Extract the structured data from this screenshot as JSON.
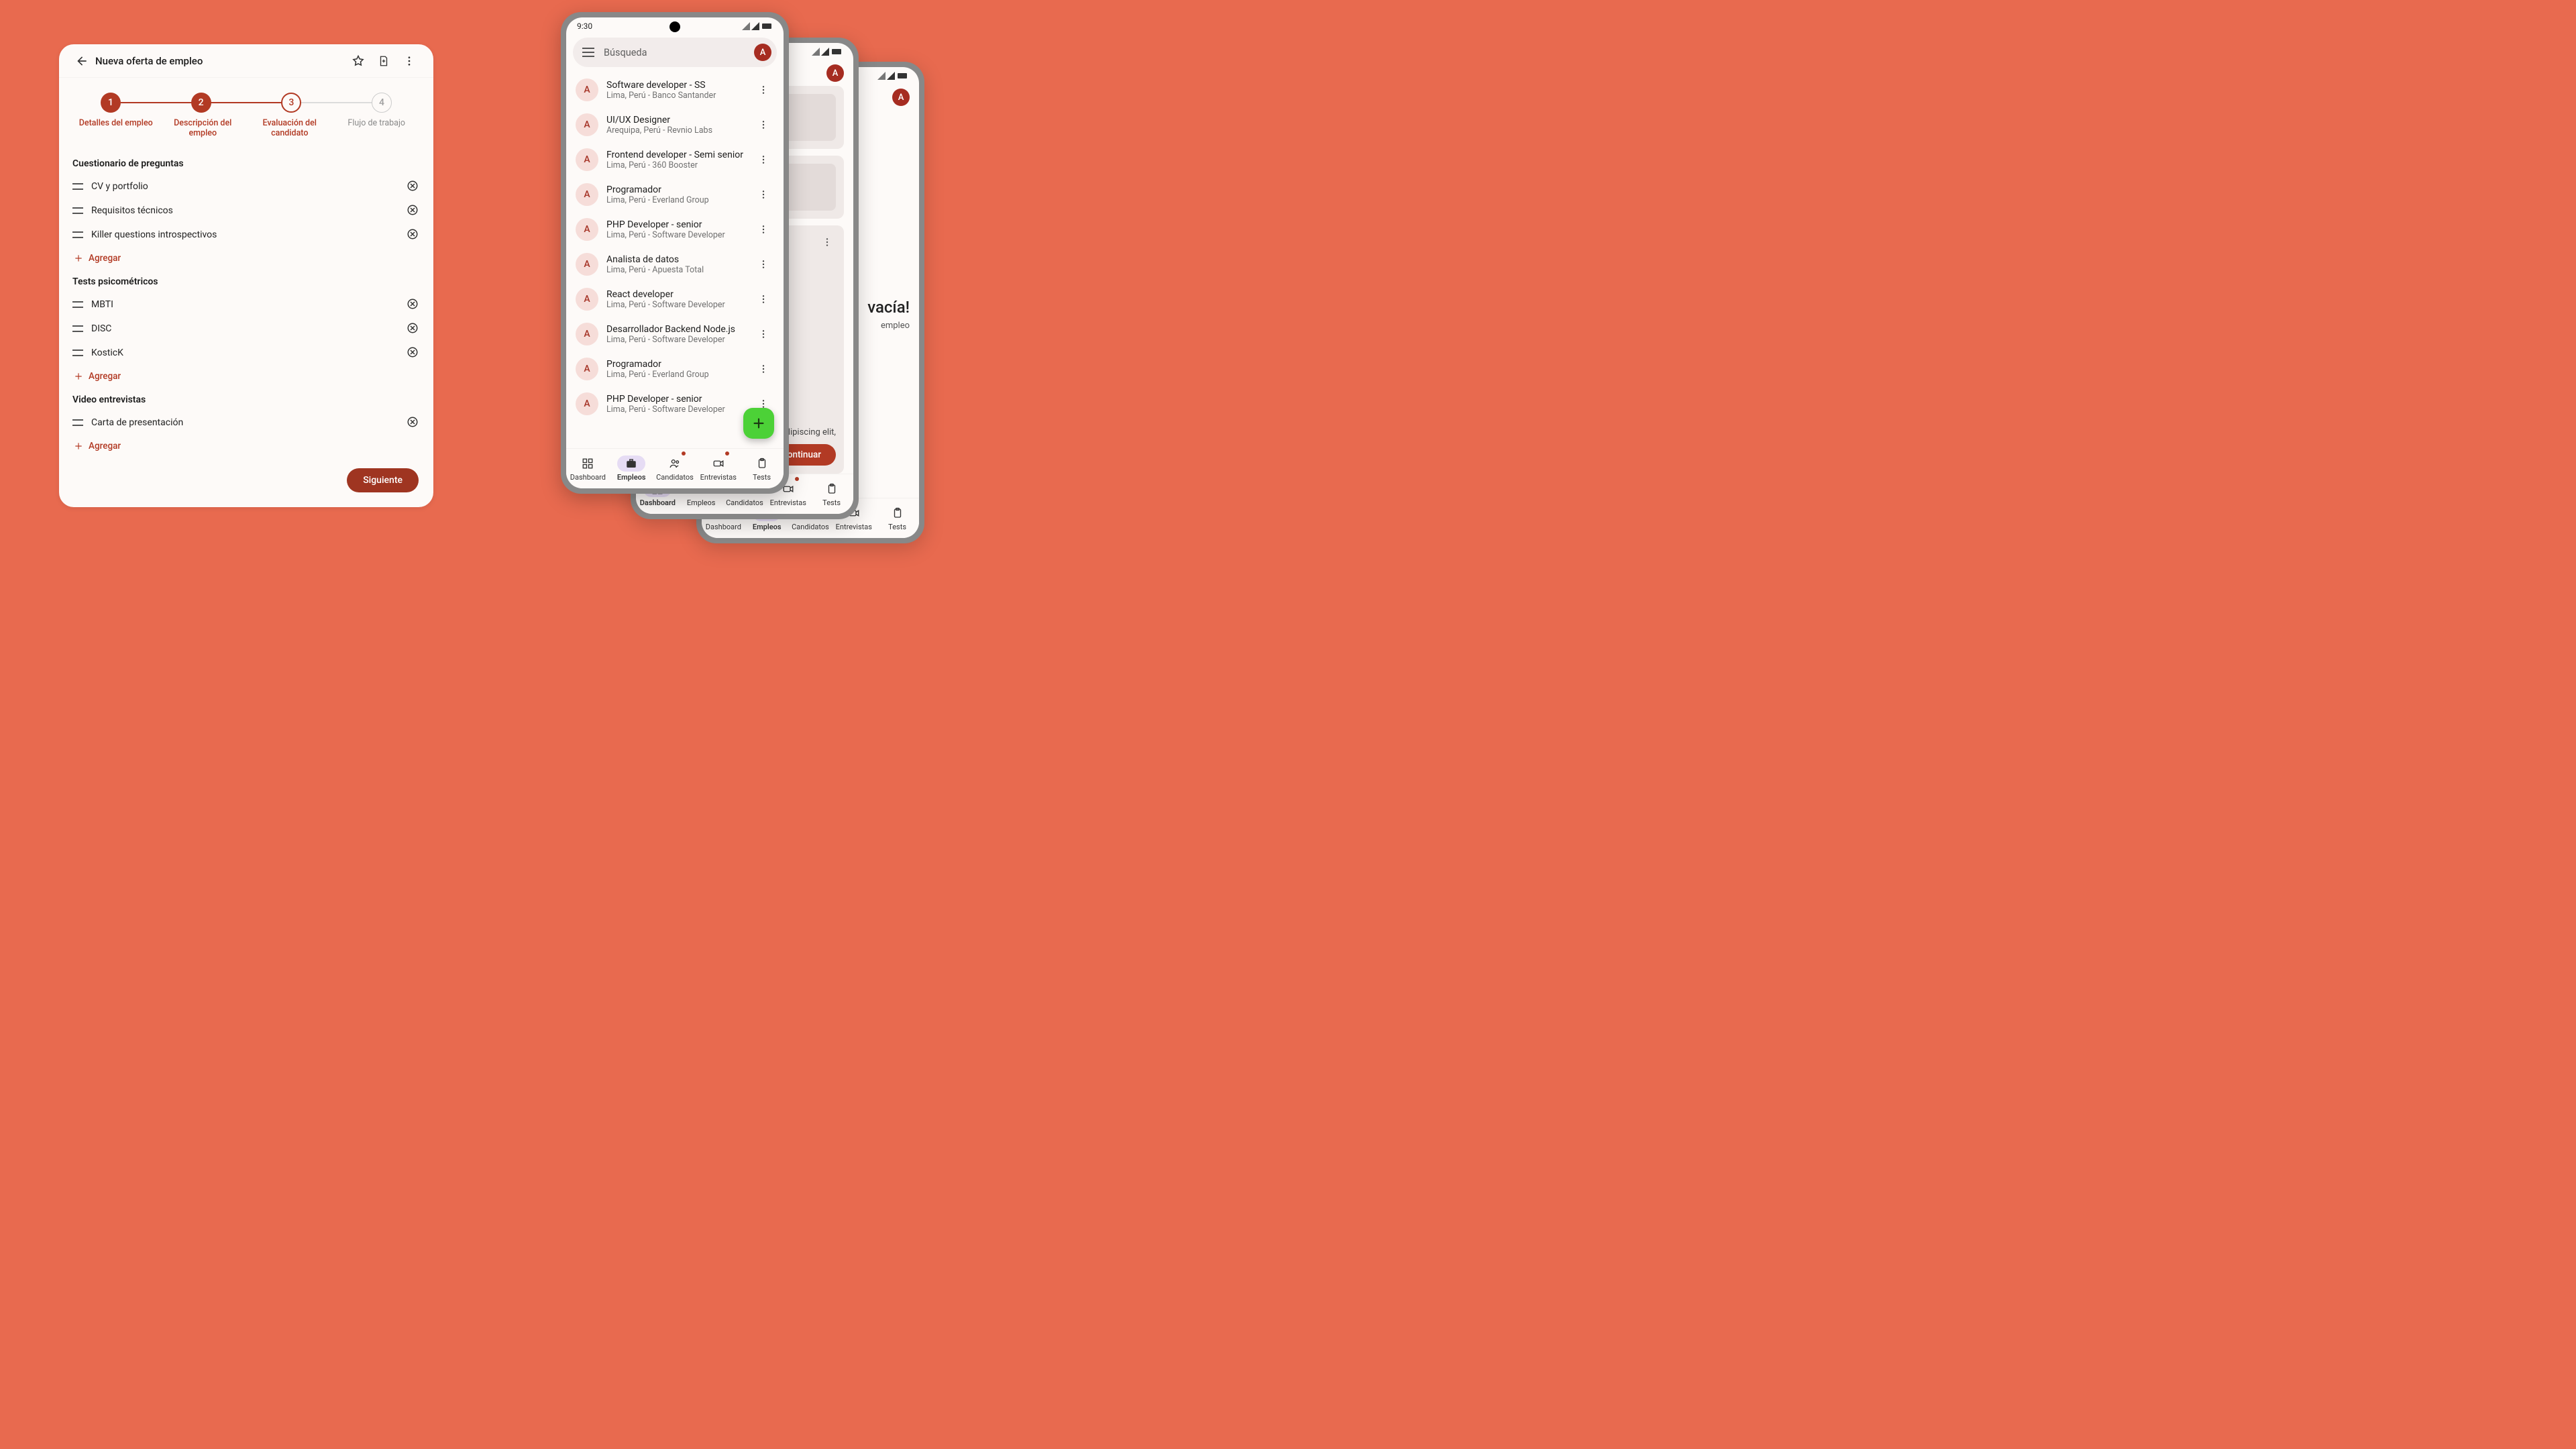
{
  "form": {
    "title": "Nueva oferta de empleo",
    "steps": [
      {
        "num": "1",
        "label": "Detalles del empleo",
        "state": "done"
      },
      {
        "num": "2",
        "label": "Descripción del empleo",
        "state": "done"
      },
      {
        "num": "3",
        "label": "Evaluación del candidato",
        "state": "current"
      },
      {
        "num": "4",
        "label": "Flujo de trabajo",
        "state": "pending"
      }
    ],
    "sections": [
      {
        "title": "Cuestionario de preguntas",
        "items": [
          "CV y portfolio",
          "Requisitos técnicos",
          "Killer questions introspectivos"
        ]
      },
      {
        "title": "Tests psicométricos",
        "items": [
          "MBTI",
          "DISC",
          "KosticK"
        ]
      },
      {
        "title": "Video entrevistas",
        "items": [
          "Carta de presentación"
        ]
      }
    ],
    "add_label": "Agregar",
    "next_label": "Siguiente"
  },
  "phoneA": {
    "time": "9:30",
    "search_placeholder": "Búsqueda",
    "avatar_letter": "A",
    "jobs": [
      {
        "title": "Software developer - SS",
        "sub": "Lima, Perú - Banco Santander"
      },
      {
        "title": "UI/UX Designer",
        "sub": "Arequipa, Perú - Revnio Labs"
      },
      {
        "title": "Frontend developer - Semi senior",
        "sub": "Lima, Perú - 360 Booster"
      },
      {
        "title": "Programador",
        "sub": "Lima, Perú - Everland Group"
      },
      {
        "title": "PHP Developer - senior",
        "sub": "Lima, Perú - Software Developer"
      },
      {
        "title": "Analista de datos",
        "sub": "Lima, Perú - Apuesta Total"
      },
      {
        "title": "React developer",
        "sub": "Lima, Perú - Software Developer"
      },
      {
        "title": "Desarrollador Backend Node.js",
        "sub": "Lima, Perú - Software Developer"
      },
      {
        "title": "Programador",
        "sub": "Lima, Perú - Everland Group"
      },
      {
        "title": "PHP Developer - senior",
        "sub": "Lima, Perú - Software Developer"
      }
    ],
    "nav": [
      "Dashboard",
      "Empleos",
      "Candidatos",
      "Entrevistas",
      "Tests"
    ],
    "nav_active": 1,
    "nav_badges": [
      false,
      false,
      true,
      true,
      false
    ]
  },
  "phoneB": {
    "avatar_letter": "A",
    "continue_label": "Continuar",
    "lorem": "adipiscing elit,",
    "nav": [
      "Dashboard",
      "Empleos",
      "Candidatos",
      "Entrevistas",
      "Tests"
    ],
    "nav_active": 0,
    "nav_badges": [
      false,
      false,
      true,
      true,
      false
    ]
  },
  "phoneC": {
    "avatar_letter": "A",
    "empty_title": "vacía!",
    "empty_sub": "empleo",
    "nav": [
      "Dashboard",
      "Empleos",
      "Candidatos",
      "Entrevistas",
      "Tests"
    ],
    "nav_active": 1,
    "nav_badges": [
      false,
      false,
      false,
      false,
      false
    ]
  }
}
